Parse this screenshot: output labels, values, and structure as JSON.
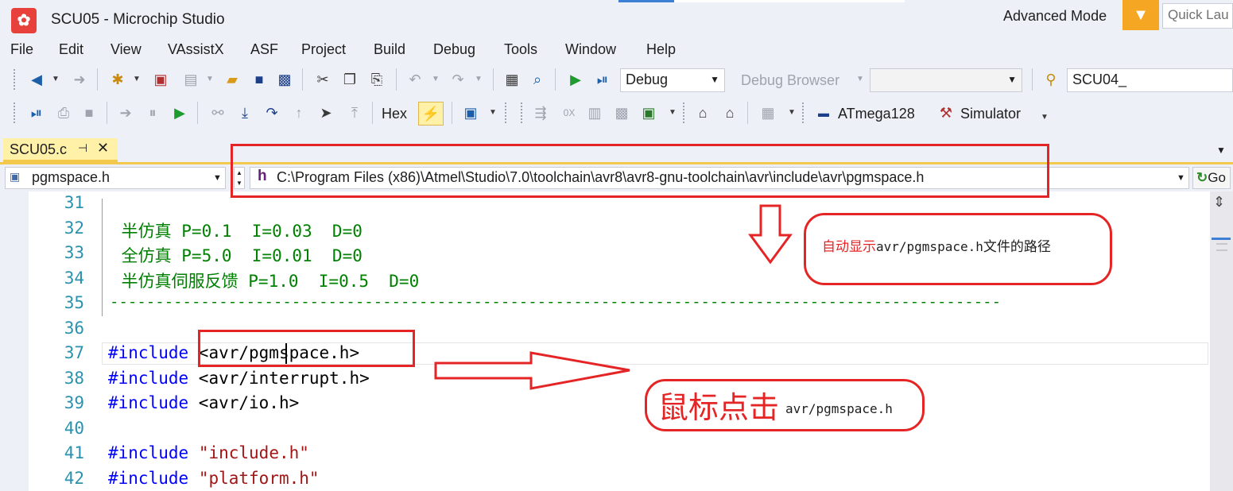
{
  "window": {
    "title": "SCU05 - Microchip Studio",
    "mode_label": "Advanced Mode",
    "quick_launch_placeholder": "Quick Lau"
  },
  "menu": [
    "File",
    "Edit",
    "View",
    "VAssistX",
    "ASF",
    "Project",
    "Build",
    "Debug",
    "Tools",
    "Window",
    "Help"
  ],
  "toolbar1": {
    "config_combo": "Debug",
    "debug_browser_label": "Debug Browser",
    "empty_combo": "",
    "project_combo": "SCU04_"
  },
  "toolbar2": {
    "hex_label": "Hex",
    "device_label": "ATmega128",
    "tool_label": "Simulator"
  },
  "tab": {
    "label": "SCU05.c",
    "pin_icon": "pin-icon",
    "close_icon": "close-icon"
  },
  "navbar": {
    "file_combo": "pgmspace.h",
    "path": "C:\\Program Files (x86)\\Atmel\\Studio\\7.0\\toolchain\\avr8\\avr8-gnu-toolchain\\avr\\include\\avr\\pgmspace.h",
    "go_label": "Go"
  },
  "code": {
    "line_numbers": [
      "31",
      "32",
      "33",
      "34",
      "35",
      "36",
      "37",
      "38",
      "39",
      "40",
      "41",
      "42"
    ],
    "line32": " 半仿真 P=0.1  I=0.03  D=0",
    "line33": " 全仿真 P=5.0  I=0.01  D=0",
    "line34": " 半仿真伺服反馈 P=1.0  I=0.5  D=0",
    "line35": "--------------------------------------------------------------------------------------------------",
    "include_kw": "#include",
    "line37_arg": " <avr/pgmspace.h>",
    "line38_arg": " <avr/interrupt.h>",
    "line39_arg": " <avr/io.h>",
    "line41_arg": "\"include.h\"",
    "line42_arg": "\"platform.h\""
  },
  "annotations": {
    "note1_red": "自动显示",
    "note1_mono": "avr/pgmspace.h",
    "note1_tail": "文件的路径",
    "note2_big": "鼠标点击",
    "note2_small": "avr/pgmspace.h"
  },
  "colors": {
    "accent_red": "#e52525",
    "tab_yellow": "#fff1a8",
    "filter_orange": "#f5a623",
    "comment_green": "#008000",
    "keyword_blue": "#0000ff",
    "string_red": "#a31515",
    "line_number": "#2b91af"
  }
}
